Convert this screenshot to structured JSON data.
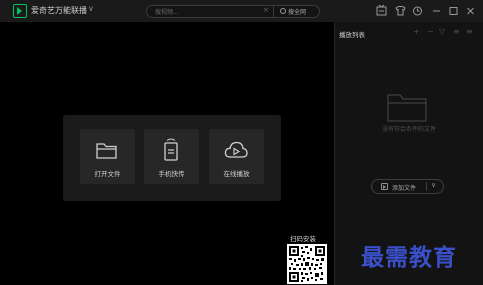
{
  "titlebar": {
    "app_name": "爱奇艺万能联播",
    "dropdown_glyph": "∨",
    "search": {
      "placeholder": "搜视频...",
      "clear_glyph": "×",
      "button_label": "搜全网"
    },
    "controls": [
      "tv-icon",
      "skin-icon",
      "history-icon",
      "minimize-icon",
      "maximize-icon",
      "close-icon"
    ]
  },
  "startup": {
    "actions": [
      {
        "label": "打开文件",
        "icon": "folder-icon"
      },
      {
        "label": "手机快传",
        "icon": "phone-transfer-icon"
      },
      {
        "label": "在线播放",
        "icon": "cloud-play-icon"
      }
    ]
  },
  "qr": {
    "label": "扫码安装"
  },
  "playlist": {
    "title": "播放列表",
    "tools": [
      "+",
      "−",
      "▽",
      "≡",
      "≡"
    ],
    "empty_text": "没有符合条件的文件",
    "add_file_label": "添加文件",
    "add_file_chevron": "∨"
  },
  "watermark": {
    "text": "最需教育"
  },
  "colors": {
    "brand": "#00c261",
    "watermark": "#3a4fc8"
  }
}
